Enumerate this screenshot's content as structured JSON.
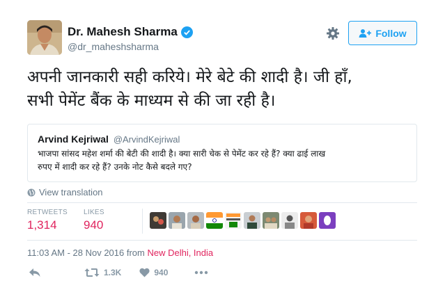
{
  "author": {
    "name": "Dr. Mahesh Sharma",
    "handle": "@dr_maheshsharma",
    "follow_label": "Follow"
  },
  "tweet": {
    "line1": "अपनी जानकारी सही करिये। मेरे बेटे की शादी है। जी हाँ,",
    "line2": "सभी पेमेंट बैंक के माध्यम से की जा रही है।"
  },
  "quoted_tweet": {
    "name": "Arvind Kejriwal",
    "handle": "@ArvindKejriwal",
    "line1": "भाजपा सांसद महेश शर्मा की बेटी की शादी है। क्या सारी चेक से पेमेंट कर रहे हैं? क्या ढाई लाख",
    "line2": "रुपए में शादी कर रहे हैं? उनके नोट कैसे बदले गए?"
  },
  "view_translation": "View translation",
  "stats": {
    "retweets_label": "RETWEETS",
    "retweets_value": "1,314",
    "likes_label": "LIKES",
    "likes_value": "940"
  },
  "timestamp": {
    "time": "11:03 AM - 28 Nov 2016 from ",
    "place": "New Delhi, India"
  },
  "actions": {
    "retweet_count": "1.3K",
    "like_count": "940"
  },
  "colors": {
    "accent": "#1da1f2",
    "stat_value": "#e0245e",
    "muted": "#657786"
  }
}
